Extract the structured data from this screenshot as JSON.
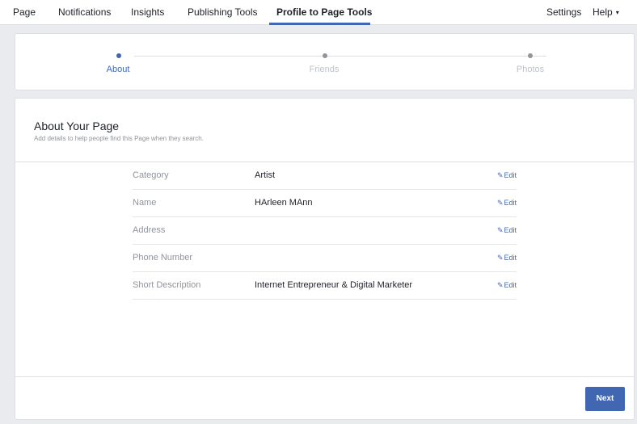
{
  "topnav": {
    "items": [
      {
        "label": "Page"
      },
      {
        "label": "Notifications"
      },
      {
        "label": "Insights"
      },
      {
        "label": "Publishing Tools"
      },
      {
        "label": "Profile to Page Tools",
        "active": true
      },
      {
        "label": "Settings"
      },
      {
        "label": "Help"
      }
    ],
    "help_caret": "▾"
  },
  "stepper": {
    "steps": [
      {
        "label": "About",
        "state": "active"
      },
      {
        "label": "Friends",
        "state": "inactive"
      },
      {
        "label": "Photos",
        "state": "inactive"
      }
    ]
  },
  "about": {
    "title": "About Your Page",
    "subtitle": "Add details to help people find this Page when they search.",
    "edit_label": "Edit",
    "rows": [
      {
        "label": "Category",
        "value": "Artist"
      },
      {
        "label": "Name",
        "value": "HArleen MAnn"
      },
      {
        "label": "Address",
        "value": ""
      },
      {
        "label": "Phone Number",
        "value": ""
      },
      {
        "label": "Short Description",
        "value": "Internet Entrepreneur & Digital Marketer"
      }
    ]
  },
  "footer": {
    "next_label": "Next"
  },
  "colors": {
    "accent": "#4267b2",
    "muted": "#90949c",
    "background": "#e9ebee"
  }
}
